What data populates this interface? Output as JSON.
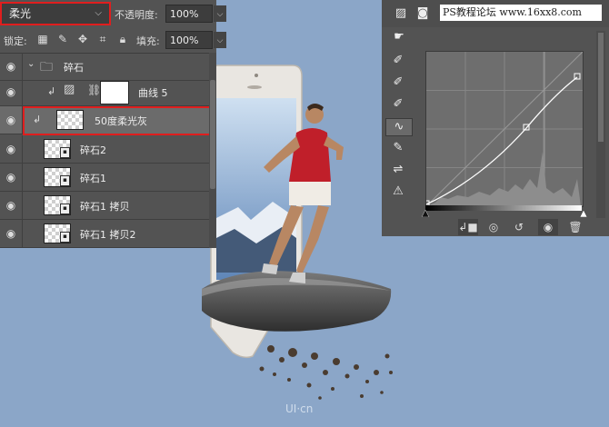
{
  "layers_panel": {
    "blend_mode": "柔光",
    "opacity_label": "不透明度:",
    "opacity_value": "100%",
    "lock_label": "锁定:",
    "fill_label": "填充:",
    "fill_value": "100%",
    "layers": [
      {
        "name": "碎石",
        "kind": "group"
      },
      {
        "name": "曲线 5",
        "kind": "adjustment"
      },
      {
        "name": "50度柔光灰",
        "kind": "pixel",
        "selected": true
      },
      {
        "name": "碎石2",
        "kind": "smart"
      },
      {
        "name": "碎石1",
        "kind": "smart"
      },
      {
        "name": "碎石1 拷贝",
        "kind": "smart"
      },
      {
        "name": "碎石1 拷贝2",
        "kind": "smart"
      }
    ]
  },
  "curves_panel": {
    "watermark": "PS教程论坛 www.16xx8.com"
  },
  "canvas": {
    "logo": "UI·cn"
  },
  "colors": {
    "background": "#8ba6c8",
    "panel": "#535353",
    "highlight": "#e01e1e"
  }
}
